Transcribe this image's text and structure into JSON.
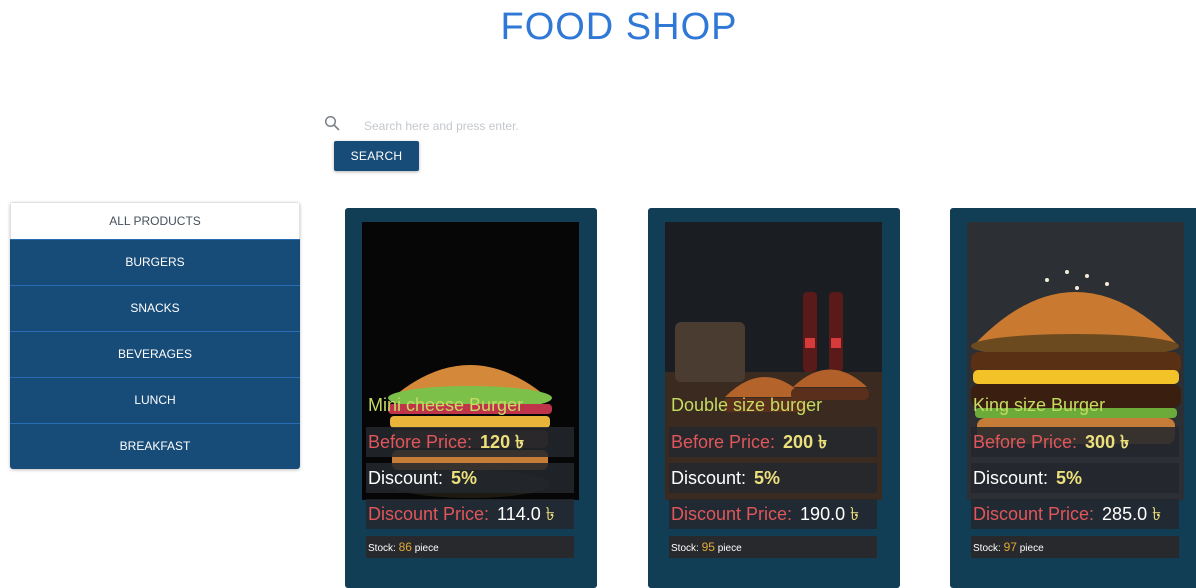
{
  "header": {
    "title": "FOOD SHOP"
  },
  "search": {
    "placeholder": "Search here and press enter.",
    "button_label": "SEARCH"
  },
  "sidebar": {
    "items": [
      {
        "label": "ALL PRODUCTS",
        "active": true
      },
      {
        "label": "BURGERS"
      },
      {
        "label": "SNACKS"
      },
      {
        "label": "BEVERAGES"
      },
      {
        "label": "LUNCH"
      },
      {
        "label": "BREAKFAST"
      }
    ]
  },
  "labels": {
    "before_price": "Before Price:",
    "discount": "Discount:",
    "discount_price": "Discount Price:",
    "stock": "Stock:",
    "piece": "piece",
    "currency": "৳"
  },
  "products": [
    {
      "name": "Mini cheese Burger",
      "before_price": "120",
      "discount": "5%",
      "discount_price": "114.0",
      "stock": "86"
    },
    {
      "name": "Double size burger",
      "before_price": "200",
      "discount": "5%",
      "discount_price": "190.0",
      "stock": "95"
    },
    {
      "name": "King size Burger",
      "before_price": "300",
      "discount": "5%",
      "discount_price": "285.0",
      "stock": "97"
    }
  ],
  "colors": {
    "brand_blue": "#184c78",
    "title_blue": "#2f78d6",
    "card_bg": "#123e55",
    "price_red": "#e0565b",
    "value_yellow": "#ece07c",
    "name_green": "#c5db62"
  }
}
